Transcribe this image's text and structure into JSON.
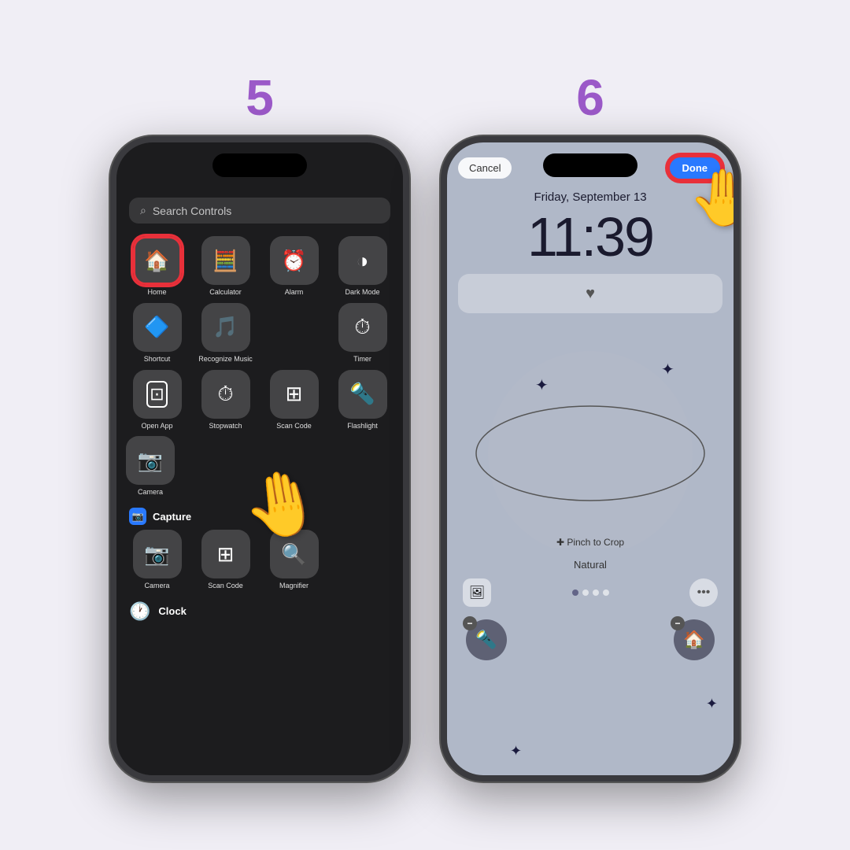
{
  "steps": {
    "step5": {
      "number": "5",
      "search_placeholder": "Search Controls",
      "controls_row1": [
        {
          "label": "Home",
          "icon": "🏠",
          "highlighted": true
        },
        {
          "label": "Calculator",
          "icon": "🧮",
          "highlighted": false
        },
        {
          "label": "Alarm",
          "icon": "⏰",
          "highlighted": false
        },
        {
          "label": "Dark Mode",
          "icon": "◑",
          "highlighted": false
        }
      ],
      "controls_row2": [
        {
          "label": "Shortcut",
          "icon": "🔷",
          "highlighted": false
        },
        {
          "label": "Recognize Music",
          "icon": "🎵",
          "highlighted": false
        },
        {
          "label": "",
          "icon": "",
          "highlighted": false
        },
        {
          "label": "Timer",
          "icon": "⏱",
          "highlighted": false
        }
      ],
      "controls_row3": [
        {
          "label": "Open App",
          "icon": "⊡",
          "highlighted": false
        },
        {
          "label": "Stopwatch",
          "icon": "⏱",
          "highlighted": false
        },
        {
          "label": "Scan Code",
          "icon": "⊞",
          "highlighted": false
        },
        {
          "label": "Flashlight",
          "icon": "🔦",
          "highlighted": false
        }
      ],
      "controls_row4": [
        {
          "label": "Camera",
          "icon": "📷",
          "highlighted": false
        }
      ],
      "section_capture": "Capture",
      "capture_items": [
        {
          "label": "Camera",
          "icon": "📷"
        },
        {
          "label": "Scan Code",
          "icon": "⊞"
        },
        {
          "label": "Magnifier",
          "icon": "🔍"
        }
      ],
      "section_clock": "Clock"
    },
    "step6": {
      "number": "6",
      "cancel_label": "Cancel",
      "done_label": "Done",
      "date_text": "Friday, September 13",
      "time_text": "11:39",
      "pinch_label": "✚ Pinch to Crop",
      "style_label": "Natural"
    }
  }
}
